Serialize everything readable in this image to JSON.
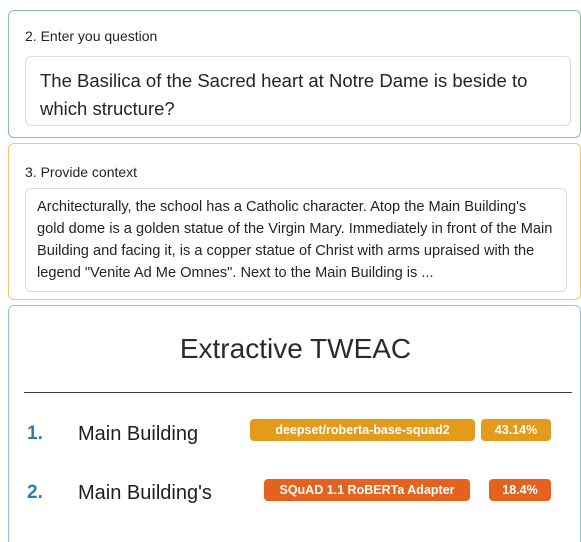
{
  "question_section": {
    "label": "2. Enter you question",
    "value": "The Basilica of the Sacred heart at Notre Dame is beside to which structure?"
  },
  "context_section": {
    "label": "3. Provide context",
    "value": "Architecturally, the school has a Catholic character. Atop the Main Building's gold dome is a golden statue of the Virgin Mary. Immediately in front of the Main Building and facing it, is a copper statue of Christ with arms upraised with the legend \"Venite Ad Me Omnes\". Next to the Main Building is ..."
  },
  "results": {
    "title": "Extractive TWEAC",
    "items": [
      {
        "rank": "1.",
        "answer": "Main Building",
        "model": "deepset/roberta-base-squad2",
        "score": "43.14%",
        "badge_color": "#e49a1b"
      },
      {
        "rank": "2.",
        "answer": "Main Building's",
        "model": "SQuAD 1.1 RoBERTa Adapter",
        "score": "18.4%",
        "badge_color": "#e5621e"
      }
    ]
  },
  "colors": {
    "question_border": "#7ec4a0",
    "context_border": "#f0c96a",
    "results_border": "#8fc7df",
    "rank_color": "#2e7bb3"
  }
}
